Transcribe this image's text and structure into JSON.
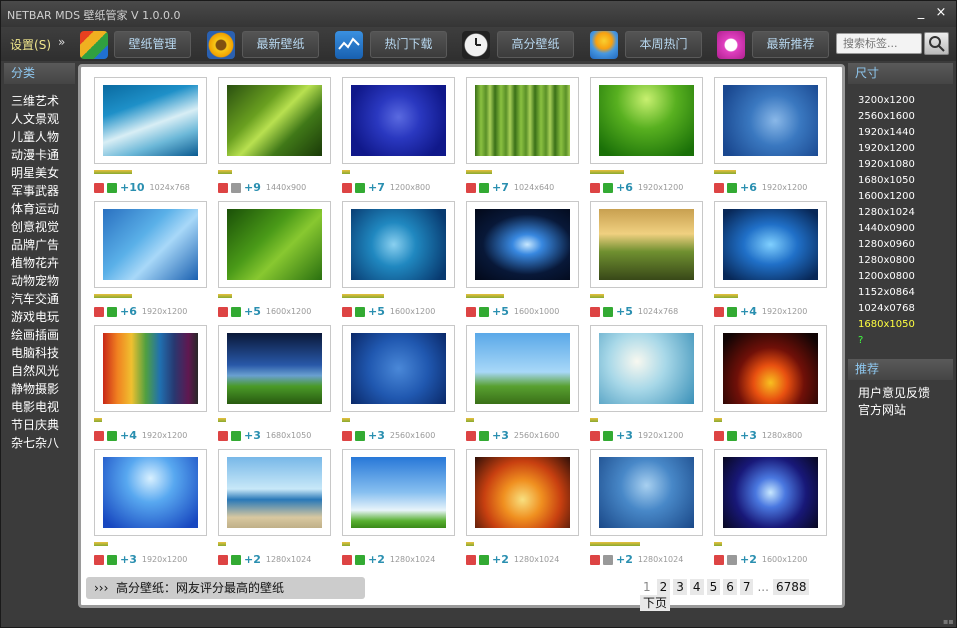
{
  "window": {
    "title": "NETBAR MDS 壁纸管家 V 1.0.0.0",
    "minimize": "_",
    "close": "×"
  },
  "toolbar": {
    "settings_label": "设置",
    "settings_key": "(S)",
    "arrow": "»",
    "buttons": [
      {
        "label": "壁纸管理",
        "icon": "wallpaper-manage-icon"
      },
      {
        "label": "最新壁纸",
        "icon": "sunflower-icon"
      },
      {
        "label": "热门下载",
        "icon": "chart-icon"
      },
      {
        "label": "高分壁纸",
        "icon": "clock-icon"
      },
      {
        "label": "本周热门",
        "icon": "sun-icon"
      },
      {
        "label": "最新推荐",
        "icon": "chat-bubble-icon"
      }
    ],
    "search_placeholder": "搜索标签..."
  },
  "categories": {
    "title": "分类",
    "items": [
      "三维艺术",
      "人文景观",
      "儿童人物",
      "动漫卡通",
      "明星美女",
      "军事武器",
      "体育运动",
      "创意视觉",
      "品牌广告",
      "植物花卉",
      "动物宠物",
      "汽车交通",
      "游戏电玩",
      "绘画插画",
      "电脑科技",
      "自然风光",
      "静物摄影",
      "电影电视",
      "节日庆典",
      "杂七杂八"
    ]
  },
  "wallpapers": [
    {
      "score": "+10",
      "res": "1024x768",
      "bg": "linear-gradient(160deg,#0a6aa0 0%,#1e90c8 30%,#d8eef5 55%,#6cb8d8 75%,#0a5a90 100%)",
      "up": true
    },
    {
      "score": "+9",
      "res": "1440x900",
      "bg": "linear-gradient(135deg,#2a5010 0%,#6aa020 35%,#b8e050 50%,#407818 70%,#1a3a08 100%)",
      "up": false
    },
    {
      "score": "+7",
      "res": "1200x800",
      "bg": "radial-gradient(circle at 50% 45%,#5a6ae0 0%,#2a38c0 35%,#10188a 80%)",
      "up": true
    },
    {
      "score": "+7",
      "res": "1024x640",
      "bg": "repeating-linear-gradient(90deg,#3a7018 0px,#8ac040 6px,#5a9028 11px,#a8d058 15px,#3a7018 20px)",
      "up": true
    },
    {
      "score": "+6",
      "res": "1920x1200",
      "bg": "radial-gradient(circle at 50% 20%,#c8f070 0%,#58b020 40%,#1a7008 90%)",
      "up": true
    },
    {
      "score": "+6",
      "res": "1920x1200",
      "bg": "radial-gradient(circle at 55% 50%,#8ab8e8 0%,#3a78c0 40%,#1a4890 90%)",
      "up": true
    },
    {
      "score": "+6",
      "res": "1920x1200",
      "bg": "linear-gradient(135deg,#2a70c0 0%,#5ab0e8 40%,#a8d8f8 60%,#1a60b0 100%)",
      "up": true
    },
    {
      "score": "+5",
      "res": "1600x1200",
      "bg": "linear-gradient(135deg,#1a5008 0%,#4a9a18 40%,#88c830 60%,#2a7010 100%)",
      "up": true
    },
    {
      "score": "+5",
      "res": "1600x1200",
      "bg": "radial-gradient(circle at 45% 50%,#8ad0f0 0%,#2088c0 35%,#083a70 90%)",
      "up": true
    },
    {
      "score": "+5",
      "res": "1600x1000",
      "bg": "radial-gradient(ellipse at 55% 50%,#c8e8ff 0%,#3888e0 20%,#081838 60%,#020818 100%)",
      "up": true
    },
    {
      "score": "+5",
      "res": "1024x768",
      "bg": "linear-gradient(180deg,#c8a050 0%,#f0d080 35%,#709030 60%,#384818 100%)",
      "up": true
    },
    {
      "score": "+4",
      "res": "1920x1200",
      "bg": "radial-gradient(ellipse at 50% 50%,#80d0ff 0%,#2070c8 40%,#082858 90%)",
      "up": true
    },
    {
      "score": "+4",
      "res": "1920x1200",
      "bg": "linear-gradient(90deg,#c82818 0%,#f08020 15%,#f0c030 30%,#50a040 45%,#2070b0 60%,#283870 75%,#601850 90%,#282828 100%)",
      "up": true
    },
    {
      "score": "+3",
      "res": "1680x1050",
      "bg": "linear-gradient(180deg,#0a1838 0%,#2858a8 45%,#6aa0d0 60%,#4a9a28 75%,#285a10 100%)",
      "up": true
    },
    {
      "score": "+3",
      "res": "2560x1600",
      "bg": "radial-gradient(circle at 50% 50%,#4a88d8 0%,#2058b0 50%,#0a2868 100%)",
      "up": true
    },
    {
      "score": "+3",
      "res": "2560x1600",
      "bg": "linear-gradient(180deg,#5aa8e8 0%,#a8d8f8 55%,#58a030 75%,#3a7018 100%)",
      "up": true
    },
    {
      "score": "+3",
      "res": "1920x1200",
      "bg": "radial-gradient(circle at 40% 40%,#f8f8f0 0%,#a8d8e8 40%,#3a90b8 100%)",
      "up": true
    },
    {
      "score": "+3",
      "res": "1280x800",
      "bg": "radial-gradient(ellipse at 50% 70%,#f8c020 0%,#e85010 25%,#701008 50%,#100404 90%)",
      "up": true
    },
    {
      "score": "+3",
      "res": "1920x1200",
      "bg": "radial-gradient(circle at 50% 30%,#d8f0ff 0%,#58a8f0 35%,#1848c0 90%)",
      "up": true
    },
    {
      "score": "+2",
      "res": "1280x1024",
      "bg": "linear-gradient(180deg,#78b8e8 0%,#c8e8f8 45%,#2878b8 60%,#d8c8a0 85%,#c0b088 100%)",
      "up": true
    },
    {
      "score": "+2",
      "res": "1280x1024",
      "bg": "linear-gradient(180deg,#2878d8 0%,#88c0f0 50%,#e8f4fa 75%,#58b030 90%,#3a8a18 100%)",
      "up": true
    },
    {
      "score": "+2",
      "res": "1280x1024",
      "bg": "radial-gradient(circle at 50% 60%,#f8e080 0%,#f09020 30%,#c84010 60%,#301008 100%)",
      "up": true
    },
    {
      "score": "+2",
      "res": "1280x1024",
      "bg": "radial-gradient(circle at 50% 40%,#a8d0f0 0%,#4888c8 40%,#1a4888 100%)",
      "up": false
    },
    {
      "score": "+2",
      "res": "1600x1200",
      "bg": "radial-gradient(circle at 50% 50%,#c8e8ff 0%,#4a78e0 25%,#181878 60%,#080820 100%)",
      "up": false
    }
  ],
  "status": {
    "arrow": "›››",
    "text": "高分壁纸：网友评分最高的壁纸"
  },
  "pager": {
    "pages": [
      "1",
      "2",
      "3",
      "4",
      "5",
      "6",
      "7"
    ],
    "ellipsis": "...",
    "last": "6788",
    "next": "下页"
  },
  "sizes": {
    "title": "尺寸",
    "items": [
      "3200x1200",
      "2560x1600",
      "1920x1440",
      "1920x1200",
      "1920x1080",
      "1680x1050",
      "1600x1200",
      "1280x1024",
      "1440x0900",
      "1280x0960",
      "1280x0800",
      "1200x0800",
      "1152x0864",
      "1024x0768",
      "1680x1050",
      "?"
    ]
  },
  "recommend": {
    "title": "推荐",
    "items": [
      "用户意见反馈",
      "官方网站"
    ]
  },
  "colors": {
    "accent": "#8fc8f0",
    "highlight": "#ffff40",
    "score": "#2a8fb0"
  }
}
